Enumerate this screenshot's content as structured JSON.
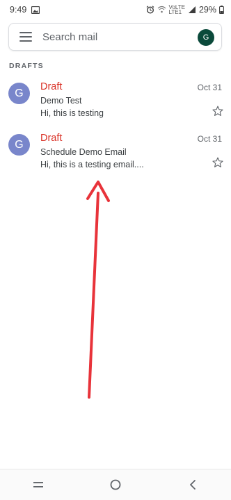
{
  "status_bar": {
    "time": "9:49",
    "network_label_top": "VoLTE",
    "network_label_bottom": "LTE1",
    "battery_percent": "29%"
  },
  "search": {
    "placeholder": "Search mail",
    "account_initial": "G"
  },
  "section": {
    "heading": "DRAFTS"
  },
  "mails": [
    {
      "avatar_initial": "G",
      "sender": "Draft",
      "date": "Oct 31",
      "subject": "Demo Test",
      "snippet": "Hi, this is testing",
      "starred": false
    },
    {
      "avatar_initial": "G",
      "sender": "Draft",
      "date": "Oct 31",
      "subject": "Schedule Demo Email",
      "snippet": "Hi, this is a testing email....",
      "starred": false
    }
  ],
  "colors": {
    "draft_label": "#d93025",
    "mail_avatar": "#7986cb",
    "account_avatar": "#0b4a3b",
    "annotation_arrow": "#e8333a"
  },
  "icons": {
    "menu": "hamburger-menu-icon",
    "star": "star-outline-icon",
    "nav_recents": "recents-icon",
    "nav_home": "home-icon",
    "nav_back": "back-icon"
  }
}
